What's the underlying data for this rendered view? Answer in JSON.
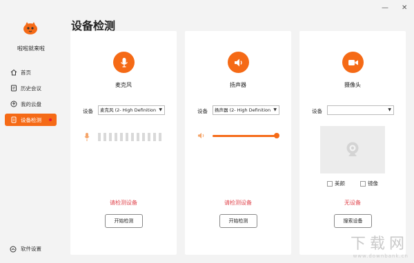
{
  "app": {
    "name": "啦啦就来啦"
  },
  "window_controls": {
    "minimize": "—",
    "close": "✕"
  },
  "sidebar": {
    "items": [
      {
        "label": "首页",
        "icon": "home-icon"
      },
      {
        "label": "历史会议",
        "icon": "history-icon"
      },
      {
        "label": "我的云盘",
        "icon": "cloud-icon"
      },
      {
        "label": "设备检测",
        "icon": "device-check-icon",
        "active": true
      }
    ],
    "settings_label": "软件设置"
  },
  "page_title": "设备检测",
  "cards": {
    "mic": {
      "title": "麦克风",
      "device_label": "设备",
      "device_value": "麦克风 (2- High Definition",
      "status": "请检测设备",
      "button": "开始检测"
    },
    "speaker": {
      "title": "扬声器",
      "device_label": "设备",
      "device_value": "扬声器 (2- High Definition",
      "status": "请检测设备",
      "button": "开始检测",
      "volume": 1.0
    },
    "camera": {
      "title": "摄像头",
      "device_label": "设备",
      "device_value": "",
      "beauty_label": "美颜",
      "mirror_label": "镜像",
      "status": "无设备",
      "button": "搜索设备"
    }
  },
  "watermark": {
    "big": "下载网",
    "small": "www.downbank.cn"
  },
  "colors": {
    "accent": "#f56a16",
    "status": "#e0464e",
    "badge": "#e8183b"
  }
}
